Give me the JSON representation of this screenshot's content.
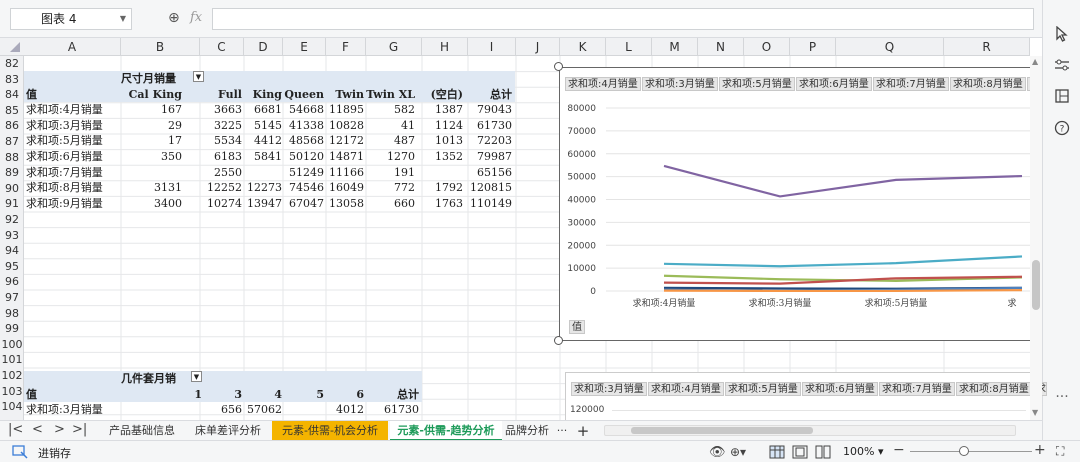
{
  "namebox": {
    "value": "图表 4"
  },
  "formula_bar": {
    "fx_label": "fx",
    "value": ""
  },
  "columns": [
    "A",
    "B",
    "C",
    "D",
    "E",
    "F",
    "G",
    "H",
    "I",
    "J",
    "K",
    "L",
    "M",
    "N",
    "O",
    "P",
    "Q",
    "R"
  ],
  "rows": [
    "82",
    "83",
    "84",
    "85",
    "86",
    "87",
    "88",
    "89",
    "90",
    "91",
    "92",
    "93",
    "94",
    "95",
    "96",
    "97",
    "98",
    "99",
    "100",
    "101",
    "102",
    "103",
    "104"
  ],
  "pivot1": {
    "title": "尺寸月销量",
    "header": [
      "值",
      "Cal King",
      "Full",
      "King",
      "Queen",
      "Twin",
      "Twin XL",
      "(空白)",
      "总计"
    ],
    "rows": [
      [
        "求和项:4月销量",
        "167",
        "3663",
        "6681",
        "54668",
        "11895",
        "582",
        "1387",
        "79043"
      ],
      [
        "求和项:3月销量",
        "29",
        "3225",
        "5145",
        "41338",
        "10828",
        "41",
        "1124",
        "61730"
      ],
      [
        "求和项:5月销量",
        "17",
        "5534",
        "4412",
        "48568",
        "12172",
        "487",
        "1013",
        "72203"
      ],
      [
        "求和项:6月销量",
        "350",
        "6183",
        "5841",
        "50120",
        "14871",
        "1270",
        "1352",
        "79987"
      ],
      [
        "求和项:7月销量",
        "",
        "2550",
        "",
        "51249",
        "11166",
        "191",
        "",
        "65156"
      ],
      [
        "求和项:8月销量",
        "3131",
        "12252",
        "12273",
        "74546",
        "16049",
        "772",
        "1792",
        "120815"
      ],
      [
        "求和项:9月销量",
        "3400",
        "10274",
        "13947",
        "67047",
        "13058",
        "660",
        "1763",
        "110149"
      ]
    ]
  },
  "pivot2": {
    "title": "几件套月销",
    "header": [
      "值",
      "1",
      "3",
      "4",
      "5",
      "6",
      "总计"
    ],
    "rows": [
      [
        "求和项:3月销量",
        "",
        "656",
        "57062",
        "",
        "4012",
        "61730"
      ]
    ]
  },
  "chart1": {
    "tabs": [
      "求和项:4月销量",
      "求和项:3月销量",
      "求和项:5月销量",
      "求和项:6月销量",
      "求和项:7月销量",
      "求和项:8月销量",
      "求"
    ],
    "value_button": "值",
    "chart_data": {
      "type": "line",
      "categories": [
        "求和项:4月销量",
        "求和项:3月销量",
        "求和项:5月销量",
        "求"
      ],
      "yticks": [
        "80000",
        "70000",
        "60000",
        "50000",
        "40000",
        "30000",
        "20000",
        "10000",
        "0"
      ],
      "ylim": [
        0,
        80000
      ],
      "series": [
        {
          "values": [
            54668,
            41338,
            48568,
            50120
          ],
          "color": "#8064a2"
        },
        {
          "values": [
            11895,
            10828,
            12172,
            14871
          ],
          "color": "#4bacc6"
        },
        {
          "values": [
            6681,
            5145,
            4412,
            5841
          ],
          "color": "#9bbb59"
        },
        {
          "values": [
            3663,
            3225,
            5534,
            6183
          ],
          "color": "#c0504d"
        },
        {
          "values": [
            1387,
            1124,
            1013,
            1352
          ],
          "color": "#1f497d"
        },
        {
          "values": [
            582,
            41,
            487,
            1270
          ],
          "color": "#4f81bd"
        },
        {
          "values": [
            167,
            29,
            17,
            350
          ],
          "color": "#f79646"
        }
      ]
    }
  },
  "chart2": {
    "tabs": [
      "求和项:3月销量",
      "求和项:4月销量",
      "求和项:5月销量",
      "求和项:6月销量",
      "求和项:7月销量",
      "求和项:8月销量",
      "求"
    ],
    "ytick_top": "120000"
  },
  "sheets": [
    {
      "label": "产品基础信息",
      "state": "normal"
    },
    {
      "label": "床单差评分析",
      "state": "normal"
    },
    {
      "label": "元素-供需-机会分析",
      "state": "highlight"
    },
    {
      "label": "元素-供需-趋势分析",
      "state": "active"
    },
    {
      "label": "品牌分析",
      "state": "normal"
    }
  ],
  "sheet_more": "···",
  "sheet_add": "+",
  "status": {
    "left_label": "进销存",
    "zoom": "100%"
  }
}
